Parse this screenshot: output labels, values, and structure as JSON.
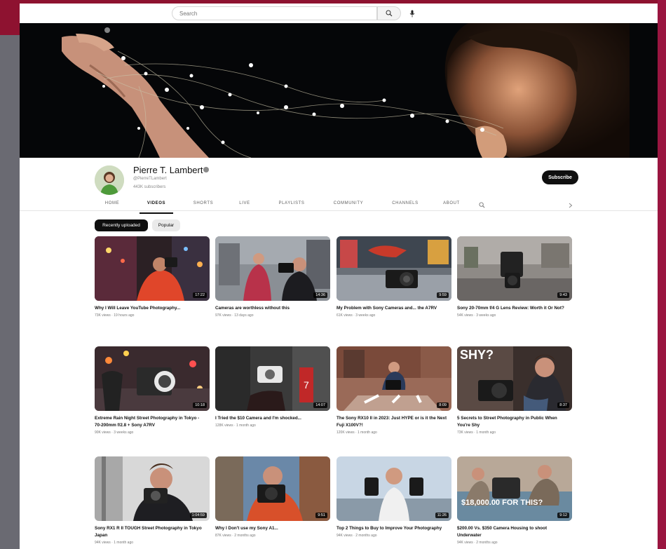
{
  "search": {
    "placeholder": "Search"
  },
  "icons": {
    "search": "search-icon",
    "mic": "mic-icon",
    "verified": "verified-icon",
    "tabs_search": "search-icon",
    "chevron": "chevron-right-icon"
  },
  "colors": {
    "subscribe_bg": "#0f0f0f",
    "chip_active_bg": "#0f0f0f",
    "chip_bg": "#eaeaea"
  },
  "channel": {
    "name": "Pierre T. Lambert",
    "handle": "@PierreTLambert",
    "subscribers": "443K subscribers",
    "subscribe_label": "Subscribe"
  },
  "tabs": [
    "HOME",
    "VIDEOS",
    "SHORTS",
    "LIVE",
    "PLAYLISTS",
    "COMMUNITY",
    "CHANNELS",
    "ABOUT"
  ],
  "chips": [
    "Recently uploaded",
    "Popular"
  ],
  "videos": [
    {
      "title": "Why I Will Leave YouTube Photography...",
      "meta": "73K views · 19 hours ago",
      "duration": "17:22"
    },
    {
      "title": "Cameras are worthless without this",
      "meta": "97K views · 13 days ago",
      "duration": "14:36"
    },
    {
      "title": "My Problem with Sony Cameras and... the A7RV",
      "meta": "61K views · 3 weeks ago",
      "duration": "9:59"
    },
    {
      "title": "Sony 20-70mm f/4 G Lens Review: Worth it Or Not?",
      "meta": "54K views · 3 weeks ago",
      "duration": "9:43"
    },
    {
      "title": "Extreme Rain Night Street Photography in Tokyo - 70-200mm f/2.8 + Sony A7RV",
      "meta": "90K views · 3 weeks ago",
      "duration": "10:18"
    },
    {
      "title": "I Tried the $10 Camera and I'm shocked...",
      "meta": "128K views · 1 month ago",
      "duration": "14:07"
    },
    {
      "title": "The Sony RX10 II in 2023: Just HYPE or is it the Next Fuji X100V?!",
      "meta": "120K views · 1 month ago",
      "duration": "8:09"
    },
    {
      "title": "5 Secrets to Street Photography in Public When You're Shy",
      "meta": "73K views · 1 month ago",
      "duration": "8:37"
    },
    {
      "title": "Sony RX1 R II TOUGH Street Photography in Tokyo Japan",
      "meta": "94K views · 1 month ago",
      "duration": "1:04:59"
    },
    {
      "title": "Why I Don't use my Sony A1...",
      "meta": "87K views · 2 months ago",
      "duration": "9:51"
    },
    {
      "title": "Top 2 Things to Buy to Improve Your Photography",
      "meta": "94K views · 2 months ago",
      "duration": "11:26"
    },
    {
      "title": "$200.00 Vs. $350 Camera Housing to shoot Underwater",
      "meta": "94K views · 2 months ago",
      "duration": "9:12"
    }
  ],
  "thumb_overlays": {
    "shy": "SHY?",
    "money": "$18,000.00 FOR THIS?"
  }
}
